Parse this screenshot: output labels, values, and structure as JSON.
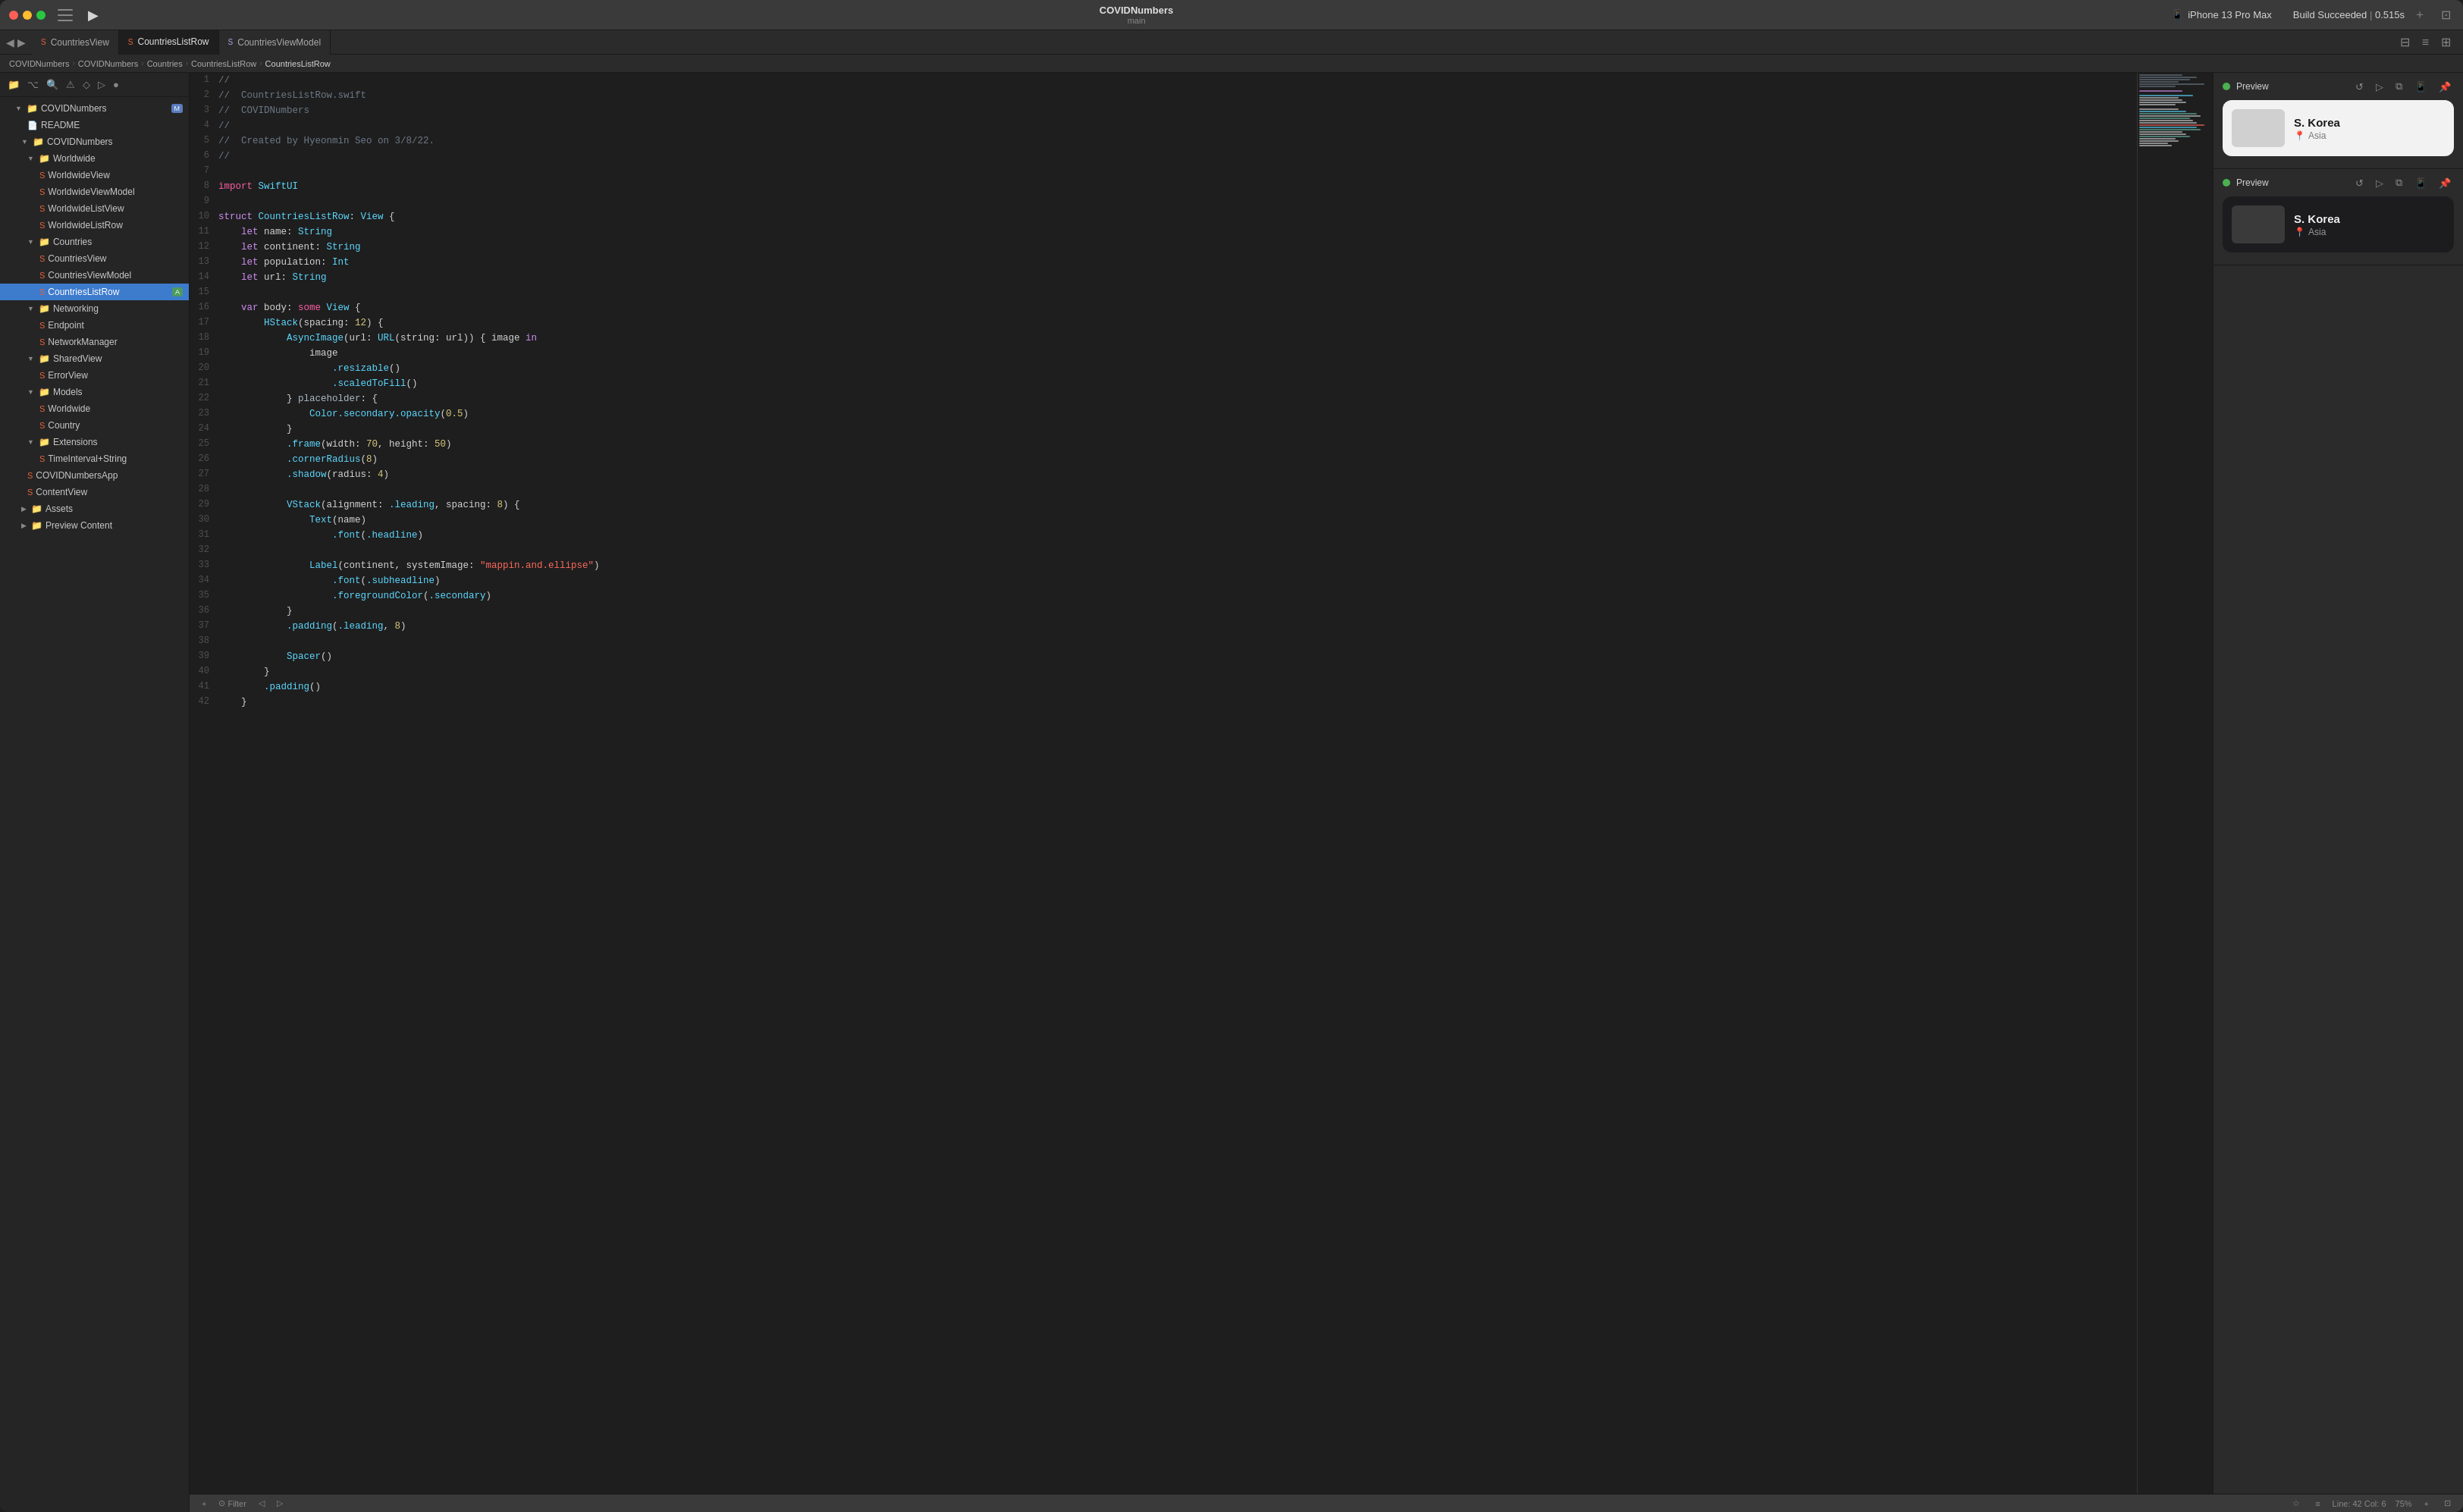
{
  "window": {
    "title": "COVIDNumbers",
    "branch": "main"
  },
  "titlebar": {
    "traffic_lights": [
      "close",
      "minimize",
      "maximize"
    ],
    "project": "COVIDNumbers",
    "branch": "main",
    "device_icon": "📱",
    "device": "iPhone 13 Pro Max",
    "build_label": "Build",
    "build_status": "Succeeded",
    "build_time": "0.515s"
  },
  "tabs": [
    {
      "label": "CountriesView",
      "type": "swift",
      "active": false
    },
    {
      "label": "CountriesListRow",
      "type": "swift",
      "active": true
    },
    {
      "label": "CountriesViewModel",
      "type": "viewmodel",
      "active": false
    }
  ],
  "breadcrumb": {
    "items": [
      "COVIDNumbers",
      "COVIDNumbers",
      "Countries",
      "CountriesListRow",
      "CountriesListRow"
    ]
  },
  "sidebar": {
    "project": "COVIDNumbers",
    "badge": "M",
    "items": [
      {
        "label": "README",
        "type": "file",
        "indent": 1,
        "arrow": false
      },
      {
        "label": "COVIDNumbers",
        "type": "folder",
        "indent": 1,
        "arrow": true,
        "expanded": true
      },
      {
        "label": "Worldwide",
        "type": "folder",
        "indent": 2,
        "arrow": true,
        "expanded": true
      },
      {
        "label": "WorldwideView",
        "type": "swift",
        "indent": 3,
        "arrow": false
      },
      {
        "label": "WorldwideViewModel",
        "type": "swift",
        "indent": 3,
        "arrow": false
      },
      {
        "label": "WorldwideListView",
        "type": "swift",
        "indent": 3,
        "arrow": false
      },
      {
        "label": "WorldwideListRow",
        "type": "swift",
        "indent": 3,
        "arrow": false
      },
      {
        "label": "Countries",
        "type": "folder",
        "indent": 2,
        "arrow": true,
        "expanded": true
      },
      {
        "label": "CountriesView",
        "type": "swift",
        "indent": 3,
        "arrow": false
      },
      {
        "label": "CountriesViewModel",
        "type": "swift",
        "indent": 3,
        "arrow": false
      },
      {
        "label": "CountriesListRow",
        "type": "swift",
        "indent": 3,
        "arrow": false,
        "active": true,
        "badge": "A"
      },
      {
        "label": "Networking",
        "type": "folder",
        "indent": 2,
        "arrow": true,
        "expanded": true
      },
      {
        "label": "Endpoint",
        "type": "swift",
        "indent": 3,
        "arrow": false
      },
      {
        "label": "NetworkManager",
        "type": "swift",
        "indent": 3,
        "arrow": false
      },
      {
        "label": "SharedView",
        "type": "folder",
        "indent": 2,
        "arrow": true,
        "expanded": true
      },
      {
        "label": "ErrorView",
        "type": "swift",
        "indent": 3,
        "arrow": false
      },
      {
        "label": "Models",
        "type": "folder",
        "indent": 2,
        "arrow": true,
        "expanded": true
      },
      {
        "label": "Worldwide",
        "type": "swift",
        "indent": 3,
        "arrow": false
      },
      {
        "label": "Country",
        "type": "swift",
        "indent": 3,
        "arrow": false
      },
      {
        "label": "Extensions",
        "type": "folder",
        "indent": 2,
        "arrow": true,
        "expanded": true
      },
      {
        "label": "TimeInterval+String",
        "type": "swift",
        "indent": 3,
        "arrow": false
      },
      {
        "label": "COVIDNumbersApp",
        "type": "swift",
        "indent": 1,
        "arrow": false
      },
      {
        "label": "ContentView",
        "type": "swift",
        "indent": 1,
        "arrow": false
      },
      {
        "label": "Assets",
        "type": "folder",
        "indent": 1,
        "arrow": false
      },
      {
        "label": "Preview Content",
        "type": "folder",
        "indent": 1,
        "arrow": false
      }
    ]
  },
  "editor": {
    "filename": "CountriesListRow.swift",
    "lines": [
      {
        "n": 1,
        "text": "//"
      },
      {
        "n": 2,
        "text": "//  CountriesListRow.swift"
      },
      {
        "n": 3,
        "text": "//  COVIDNumbers"
      },
      {
        "n": 4,
        "text": "//"
      },
      {
        "n": 5,
        "text": "//  Created by Hyeonmin Seo on 3/8/22."
      },
      {
        "n": 6,
        "text": "//"
      },
      {
        "n": 7,
        "text": ""
      },
      {
        "n": 8,
        "text": "import SwiftUI"
      },
      {
        "n": 9,
        "text": ""
      },
      {
        "n": 10,
        "text": "struct CountriesListRow: View {"
      },
      {
        "n": 11,
        "text": "    let name: String"
      },
      {
        "n": 12,
        "text": "    let continent: String"
      },
      {
        "n": 13,
        "text": "    let population: Int"
      },
      {
        "n": 14,
        "text": "    let url: String"
      },
      {
        "n": 15,
        "text": ""
      },
      {
        "n": 16,
        "text": "    var body: some View {"
      },
      {
        "n": 17,
        "text": "        HStack(spacing: 12) {"
      },
      {
        "n": 18,
        "text": "            AsyncImage(url: URL(string: url)) { image in"
      },
      {
        "n": 19,
        "text": "                image"
      },
      {
        "n": 20,
        "text": "                    .resizable()"
      },
      {
        "n": 21,
        "text": "                    .scaledToFill()"
      },
      {
        "n": 22,
        "text": "            } placeholder: {"
      },
      {
        "n": 23,
        "text": "                Color.secondary.opacity(0.5)"
      },
      {
        "n": 24,
        "text": "            }"
      },
      {
        "n": 25,
        "text": "            .frame(width: 70, height: 50)"
      },
      {
        "n": 26,
        "text": "            .cornerRadius(8)"
      },
      {
        "n": 27,
        "text": "            .shadow(radius: 4)"
      },
      {
        "n": 28,
        "text": ""
      },
      {
        "n": 29,
        "text": "            VStack(alignment: .leading, spacing: 8) {"
      },
      {
        "n": 30,
        "text": "                Text(name)"
      },
      {
        "n": 31,
        "text": "                    .font(.headline)"
      },
      {
        "n": 32,
        "text": ""
      },
      {
        "n": 33,
        "text": "                Label(continent, systemImage: \"mappin.and.ellipse\")"
      },
      {
        "n": 34,
        "text": "                    .font(.subheadline)"
      },
      {
        "n": 35,
        "text": "                    .foregroundColor(.secondary)"
      },
      {
        "n": 36,
        "text": "            }"
      },
      {
        "n": 37,
        "text": "            .padding(.leading, 8)"
      },
      {
        "n": 38,
        "text": ""
      },
      {
        "n": 39,
        "text": "            Spacer()"
      },
      {
        "n": 40,
        "text": "        }"
      },
      {
        "n": 41,
        "text": "        .padding()"
      },
      {
        "n": 42,
        "text": "    }"
      }
    ]
  },
  "preview": {
    "sections": [
      {
        "label": "Preview",
        "dark": false,
        "country": "S. Korea",
        "region": "Asia"
      },
      {
        "label": "Preview",
        "dark": true,
        "country": "S. Korea",
        "region": "Asia"
      }
    ]
  },
  "status_bar": {
    "add_btn": "+",
    "filter_placeholder": "Filter",
    "warning_icon": "⚠",
    "line_col": "Line: 42  Col: 6",
    "zoom": "75%"
  }
}
